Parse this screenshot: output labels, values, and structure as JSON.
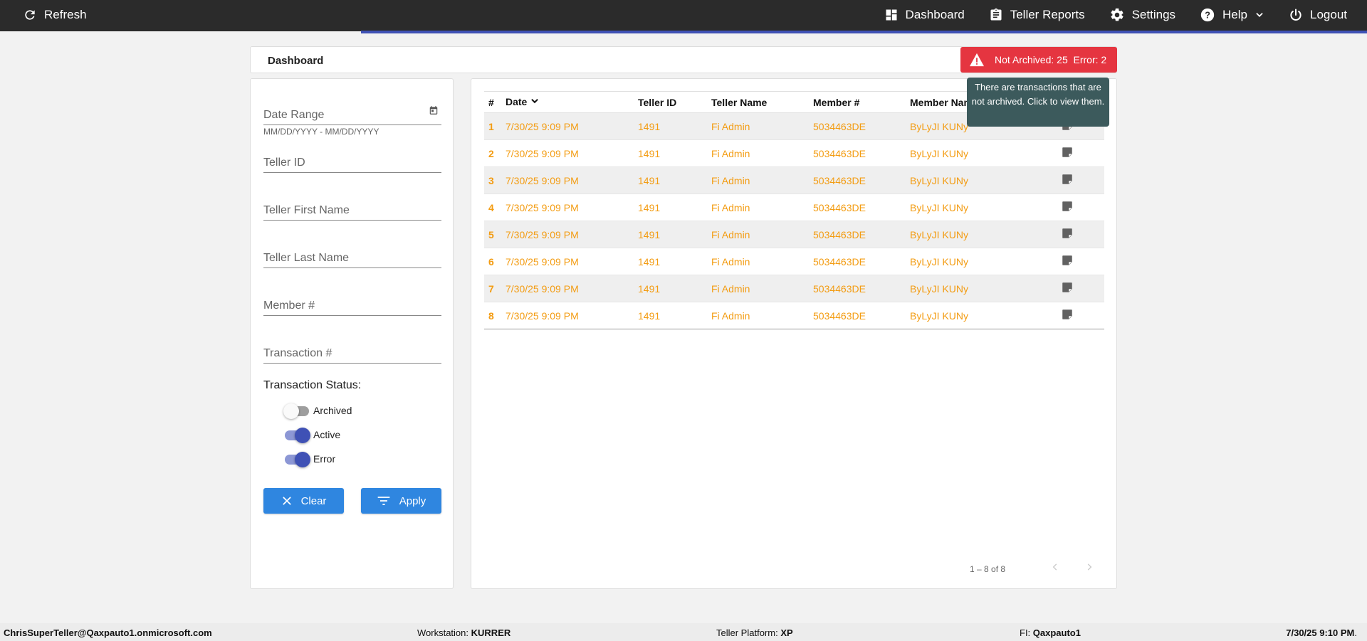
{
  "topbar": {
    "refresh_label": "Refresh",
    "nav": [
      {
        "label": "Dashboard",
        "icon": "dashboard-icon"
      },
      {
        "label": "Teller Reports",
        "icon": "clipboard-icon"
      },
      {
        "label": "Settings",
        "icon": "gear-icon"
      },
      {
        "label": "Help",
        "icon": "help-icon"
      },
      {
        "label": "Logout",
        "icon": "power-icon"
      }
    ],
    "accent": "#3f51b5"
  },
  "page_title": "Dashboard",
  "alert": {
    "text": "Not Archived: 25  Error: 2",
    "color": "#e53540",
    "tooltip": "There are transactions that are not archived. Click to view them."
  },
  "filters": {
    "date_range_placeholder": "Date Range",
    "date_hint": "MM/DD/YYYY - MM/DD/YYYY",
    "teller_id_placeholder": "Teller ID",
    "teller_first_placeholder": "Teller First Name",
    "teller_last_placeholder": "Teller Last Name",
    "member_placeholder": "Member #",
    "transaction_placeholder": "Transaction #",
    "status_label": "Transaction Status:",
    "toggles": [
      {
        "label": "Archived",
        "on": false
      },
      {
        "label": "Active",
        "on": true
      },
      {
        "label": "Error",
        "on": true
      }
    ],
    "clear_label": "Clear",
    "apply_label": "Apply"
  },
  "table": {
    "columns": [
      "#",
      "Date",
      "Teller ID",
      "Teller Name",
      "Member #",
      "Member Nam"
    ],
    "rows": [
      {
        "num": "1",
        "date": "7/30/25 9:09 PM",
        "teller_id": "1491",
        "teller_name": "Fi Admin",
        "member": "5034463DE",
        "member_name": "ByLyJI KUNy"
      },
      {
        "num": "2",
        "date": "7/30/25 9:09 PM",
        "teller_id": "1491",
        "teller_name": "Fi Admin",
        "member": "5034463DE",
        "member_name": "ByLyJI KUNy"
      },
      {
        "num": "3",
        "date": "7/30/25 9:09 PM",
        "teller_id": "1491",
        "teller_name": "Fi Admin",
        "member": "5034463DE",
        "member_name": "ByLyJI KUNy"
      },
      {
        "num": "4",
        "date": "7/30/25 9:09 PM",
        "teller_id": "1491",
        "teller_name": "Fi Admin",
        "member": "5034463DE",
        "member_name": "ByLyJI KUNy"
      },
      {
        "num": "5",
        "date": "7/30/25 9:09 PM",
        "teller_id": "1491",
        "teller_name": "Fi Admin",
        "member": "5034463DE",
        "member_name": "ByLyJI KUNy"
      },
      {
        "num": "6",
        "date": "7/30/25 9:09 PM",
        "teller_id": "1491",
        "teller_name": "Fi Admin",
        "member": "5034463DE",
        "member_name": "ByLyJI KUNy"
      },
      {
        "num": "7",
        "date": "7/30/25 9:09 PM",
        "teller_id": "1491",
        "teller_name": "Fi Admin",
        "member": "5034463DE",
        "member_name": "ByLyJI KUNy"
      },
      {
        "num": "8",
        "date": "7/30/25 9:09 PM",
        "teller_id": "1491",
        "teller_name": "Fi Admin",
        "member": "5034463DE",
        "member_name": "ByLyJI KUNy"
      }
    ],
    "row_color": "#f39c12",
    "pager_text": "1 – 8 of 8"
  },
  "statusbar": {
    "user": "ChrisSuperTeller@Qaxpauto1.onmicrosoft.com",
    "workstation_label": "Workstation:",
    "workstation": "KURRER",
    "platform_label": "Teller Platform:",
    "platform": "XP",
    "fi_label": "FI:",
    "fi": "Qaxpauto1",
    "datetime": "7/30/25 9:10 PM",
    "datetime_suffix": "."
  }
}
